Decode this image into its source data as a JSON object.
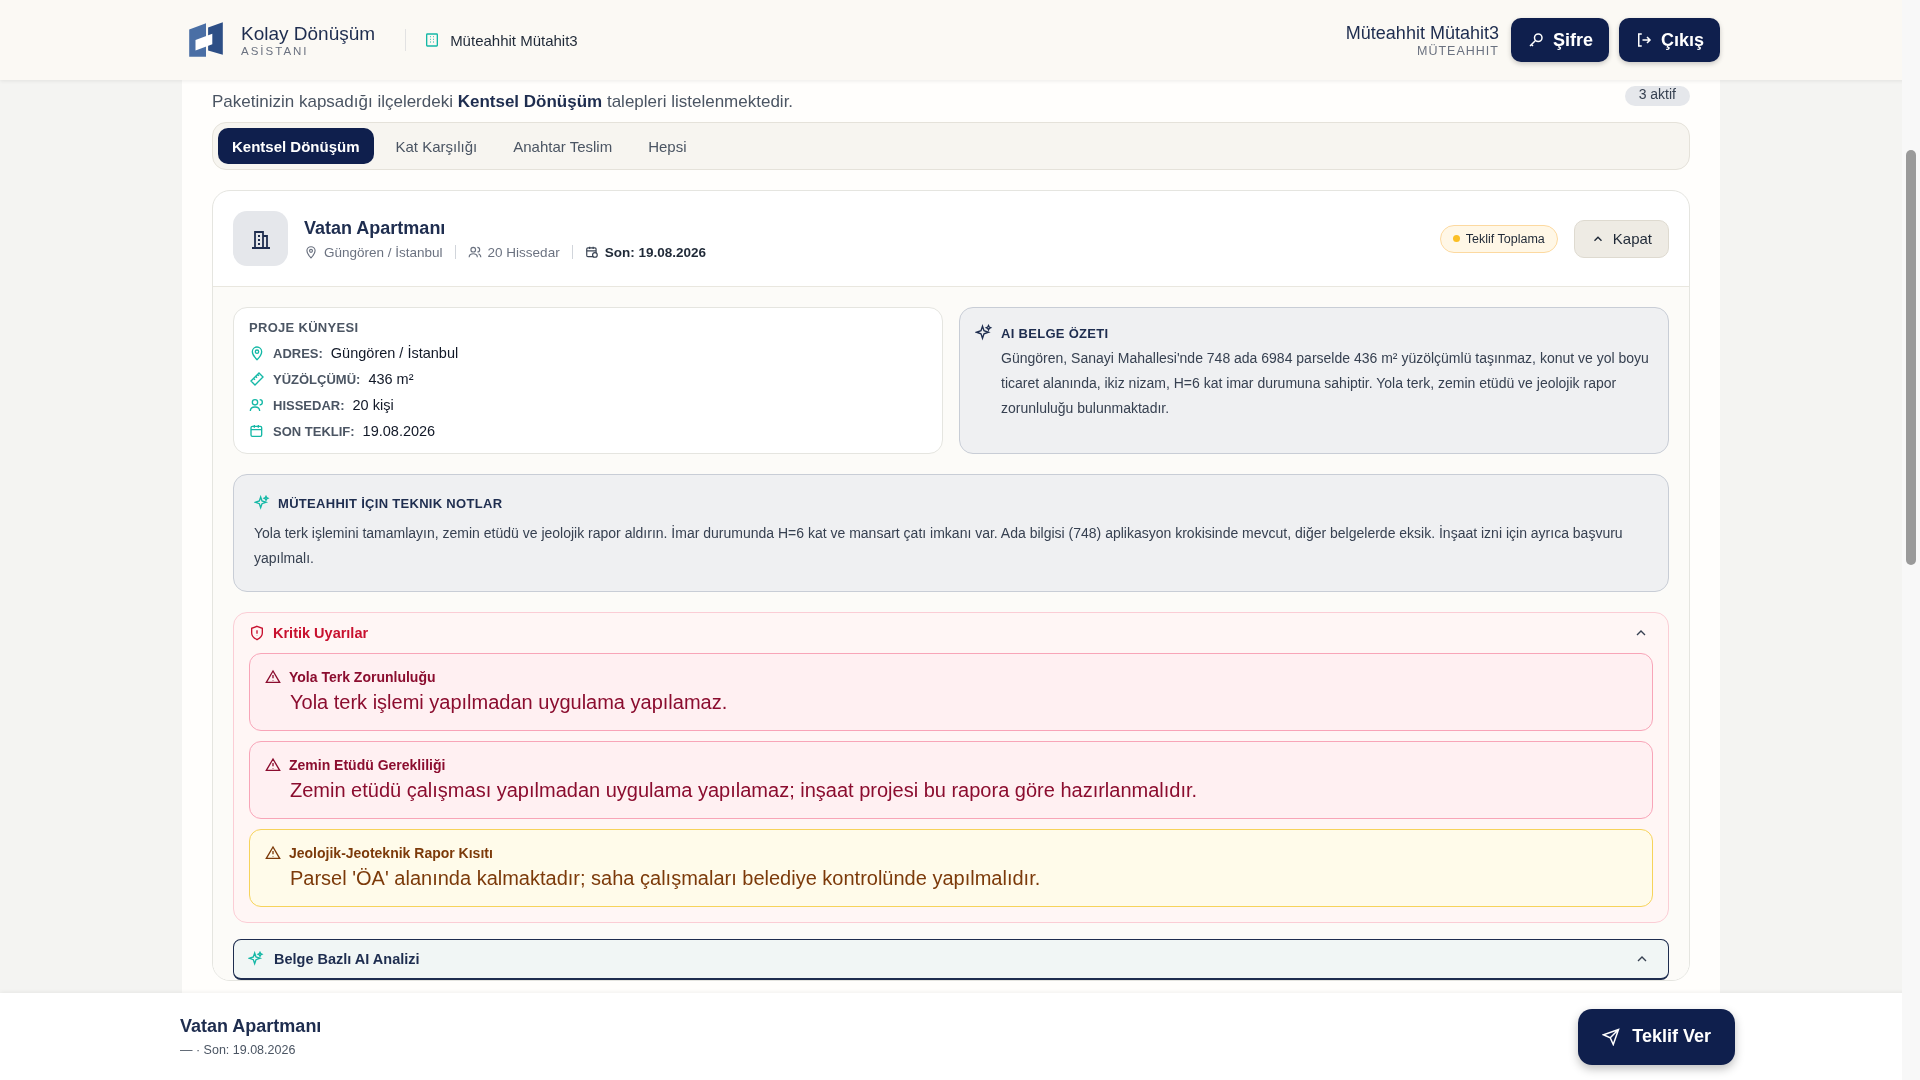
{
  "header": {
    "brand": "Kolay Dönüşüm",
    "brand_sub": "ASİSTANI",
    "company": "Müteahhit Mütahit3",
    "user_name": "Müteahhit Mütahit3",
    "user_role": "MÜTEAHHIT",
    "buttons": [
      "Şifre",
      "Çıkış"
    ]
  },
  "intro": {
    "text": "Paketinizin kapsadığı ilçelerdeki **Kentsel Dönüşüm** talepleri listelenmektedir.",
    "badge": "3 aktif"
  },
  "tabs": [
    {
      "label": "Kentsel Dönüşüm",
      "selected": true
    },
    {
      "label": "Kat Karşılığı",
      "selected": false
    },
    {
      "label": "Anahtar Teslim",
      "selected": false
    },
    {
      "label": "Hepsi",
      "selected": false
    }
  ],
  "project": {
    "name": "Vatan Apartmanı",
    "location": "Güngören / İstanbul",
    "shareholders": "20 Hissedar",
    "deadline": "Son: 19.08.2026",
    "status": "Teklif Toplama",
    "collapse_button": "Kapat",
    "expanded": true
  },
  "details": {
    "title": "PROJE KÜNYESI",
    "rows": [
      {
        "kind": "location",
        "label": "ADRES:",
        "value": "Güngören / İstanbul"
      },
      {
        "kind": "area",
        "label": "YÜZÖLÇÜMÜ:",
        "value": "436 m²"
      },
      {
        "kind": "people",
        "label": "HISSEDAR:",
        "value": "20 kişi"
      },
      {
        "kind": "date",
        "label": "SON TEKLIF:",
        "value": "19.08.2026"
      }
    ]
  },
  "ai_summary": {
    "title": "AI BELGE ÖZETI",
    "text": "Güngören, Sanayi Mahallesi'nde 748 ada 6984 parselde 436 m² yüzölçümlü taşınmaz, konut ve yol boyu ticaret alanında, ikiz nizam, H=6 kat imar durumuna sahiptir. Yola terk, zemin etüdü ve jeolojik rapor zorunluluğu bulunmaktadır."
  },
  "technical_notes": {
    "title": "MÜTEAHHIT İÇIN TEKNIK NOTLAR",
    "text": "Yola terk işlemini tamamlayın, zemin etüdü ve jeolojik rapor aldırın. İmar durumunda H=6 kat ve mansart çatı imkanı var. Ada bilgisi (748) aplikasyon krokisinde mevcut, diğer belgelerde eksik. İnşaat izni için ayrıca başvuru yapılmalı."
  },
  "critical_warnings": {
    "title": "Kritik Uyarılar",
    "expanded": true,
    "items": [
      {
        "kind": "danger",
        "title": "Yola Terk Zorunluluğu",
        "text": "Yola terk işlemi yapılmadan uygulama yapılamaz."
      },
      {
        "kind": "danger",
        "title": "Zemin Etüdü Gerekliliği",
        "text": "Zemin etüdü çalışması yapılmadan uygulama yapılamaz; inşaat projesi bu rapora göre hazırlanmalıdır."
      },
      {
        "kind": "warning",
        "title": "Jeolojik-Jeoteknik Rapor Kısıtı",
        "text": "Parsel 'ÖA' alanında kalmaktadır; saha çalışmaları belediye kontrolünde yapılmalıdır."
      }
    ]
  },
  "ai_analysis": {
    "title": "Belge Bazlı AI Analizi",
    "expanded": true
  },
  "footer": {
    "name": "Vatan Apartmanı",
    "sub": "— · Son: 19.08.2026",
    "button": "Teklif Ver"
  }
}
